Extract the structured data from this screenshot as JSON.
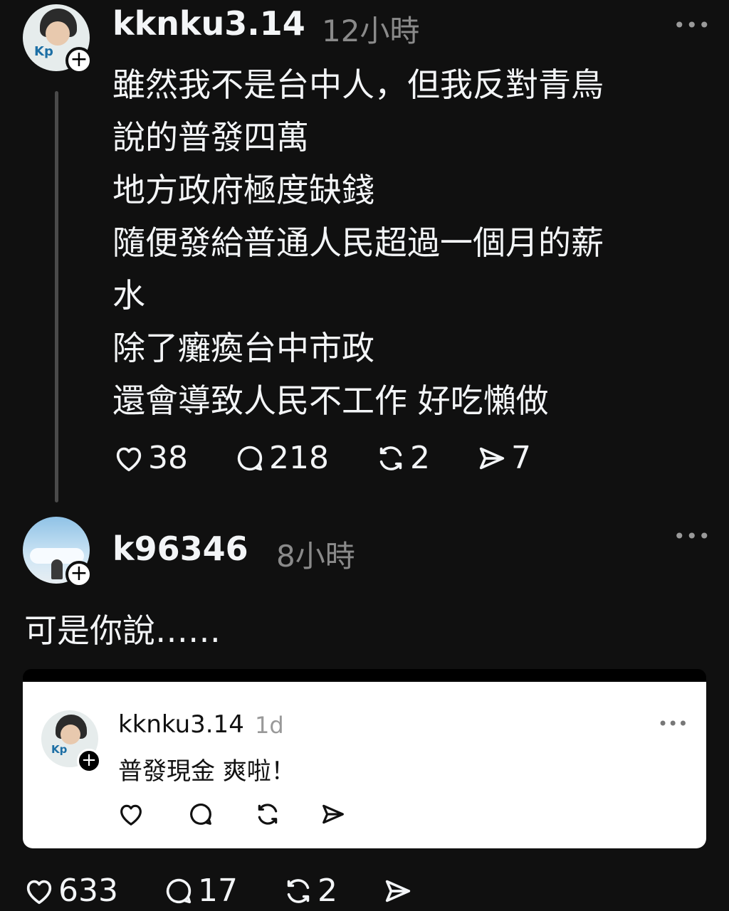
{
  "post1": {
    "username": "kknku3.14",
    "time": "12小時",
    "more_icon": "more-horizontal-icon",
    "lines": [
      "雖然我不是台中人，但我反對青鳥",
      "說的普發四萬",
      "地方政府極度缺錢",
      "隨便發給普通人民超過一個月的薪",
      "水",
      "除了癱瘓台中市政",
      "還會導致人民不工作 好吃懶做"
    ],
    "likes": "38",
    "comments": "218",
    "reposts": "2",
    "shares": "7"
  },
  "post2": {
    "username": "k96346",
    "time": "8小時",
    "text": "可是你說……",
    "likes": "633",
    "comments": "17",
    "reposts": "2"
  },
  "quoted": {
    "username": "kknku3.14",
    "time": "1d",
    "text": "普發現金 爽啦！"
  },
  "colors": {
    "background": "#101010",
    "text": "#f3f5f7",
    "muted": "#8a8a8a",
    "card": "#ffffff"
  }
}
